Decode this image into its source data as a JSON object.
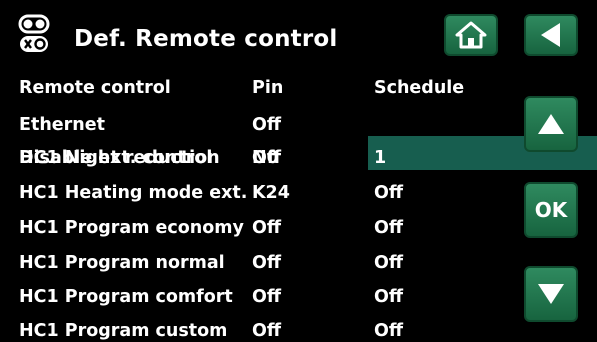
{
  "header": {
    "title": "Def. Remote control",
    "home_icon": "home-icon",
    "back_icon": "back-arrow-icon",
    "menu_icon": "toggle-switch-icon"
  },
  "table": {
    "headers": {
      "name": "Remote control",
      "pin": "Pin",
      "schedule": "Schedule"
    },
    "rows": [
      {
        "name": "Ethernet",
        "pin": "Off",
        "schedule": ""
      },
      {
        "name": "Disable ext. control",
        "name_overlap": "HC1 Night reduction",
        "pin": "N0",
        "pin_overlap": "Off",
        "schedule": "1"
      },
      {
        "name": "HC1 Heating mode ext.",
        "pin": "K24",
        "schedule": "Off"
      },
      {
        "name": "HC1 Program economy",
        "pin": "Off",
        "schedule": "Off"
      },
      {
        "name": "HC1 Program normal",
        "pin": "Off",
        "schedule": "Off"
      },
      {
        "name": "HC1 Program comfort",
        "pin": "Off",
        "schedule": "Off"
      },
      {
        "name": "HC1 Program custom",
        "pin": "Off",
        "schedule": "Off"
      }
    ]
  },
  "controls": {
    "ok_label": "OK",
    "up_icon": "arrow-up-icon",
    "down_icon": "arrow-down-icon"
  },
  "colors": {
    "button_green": "#1f7a4d",
    "highlight": "#175e4f",
    "background": "#000000",
    "text": "#ffffff"
  }
}
